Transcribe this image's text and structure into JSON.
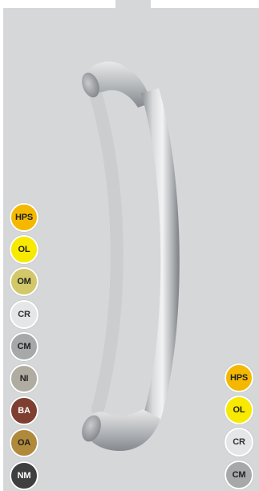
{
  "finishes_left": [
    {
      "code": "HPS",
      "color": "#f5b800",
      "text_color": "#222222"
    },
    {
      "code": "OL",
      "color": "#f7e900",
      "text_color": "#222222"
    },
    {
      "code": "OM",
      "color": "#d2c86a",
      "text_color": "#222222"
    },
    {
      "code": "CR",
      "color": "#e4e6e8",
      "text_color": "#333333"
    },
    {
      "code": "CM",
      "color": "#a6a8aa",
      "text_color": "#222222"
    },
    {
      "code": "NI",
      "color": "#b1aca2",
      "text_color": "#222222"
    },
    {
      "code": "BA",
      "color": "#7e3f31",
      "text_color": "#ffffff"
    },
    {
      "code": "OA",
      "color": "#b08a3c",
      "text_color": "#222222"
    },
    {
      "code": "NM",
      "color": "#3f3f3f",
      "text_color": "#ffffff"
    }
  ],
  "finishes_right": [
    {
      "code": "HPS",
      "color": "#f5b800",
      "text_color": "#222222"
    },
    {
      "code": "OL",
      "color": "#f7e900",
      "text_color": "#222222"
    },
    {
      "code": "CR",
      "color": "#e4e6e8",
      "text_color": "#333333"
    },
    {
      "code": "CM",
      "color": "#a6a8aa",
      "text_color": "#222222"
    }
  ]
}
